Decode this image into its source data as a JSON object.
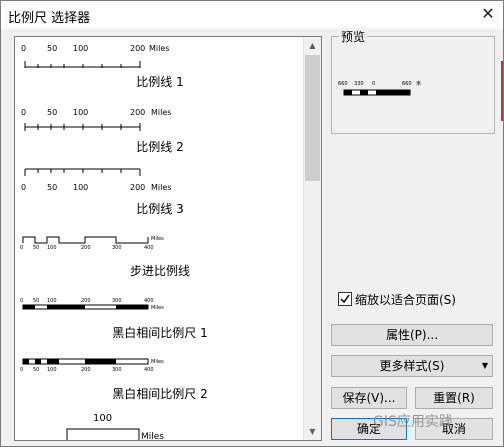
{
  "window": {
    "title": "比例尺 选择器"
  },
  "list": {
    "items": [
      {
        "name": "比例线 1",
        "ticks": [
          "0",
          "50",
          "100",
          "200"
        ],
        "unit": "Miles"
      },
      {
        "name": "比例线 2",
        "ticks": [
          "0",
          "50",
          "100",
          "200"
        ],
        "unit": "Miles"
      },
      {
        "name": "比例线 3",
        "ticks": [
          "0",
          "50",
          "100",
          "200"
        ],
        "unit": "Miles"
      },
      {
        "name": "步进比例线",
        "ticks": [
          "0",
          "50",
          "100",
          "200",
          "300",
          "400"
        ],
        "unit": "Miles"
      },
      {
        "name": "黑白相间比例尺 1",
        "ticks": [
          "0",
          "50",
          "100",
          "200",
          "300",
          "400"
        ],
        "unit": "Miles"
      },
      {
        "name": "黑白相间比例尺 2",
        "ticks": [
          "0",
          "50",
          "100",
          "200",
          "300",
          "400"
        ],
        "unit": "Miles"
      },
      {
        "name": "",
        "ticks": [
          "100"
        ],
        "unit": "Miles"
      }
    ]
  },
  "preview": {
    "title": "预览",
    "ticks": [
      "660",
      "330",
      "0",
      "660"
    ],
    "unit": "米"
  },
  "options": {
    "fit_to_page_label": "缩放以适合页面(S)",
    "fit_to_page_checked": true
  },
  "buttons": {
    "properties": "属性(P)...",
    "more_styles": "更多样式(S)",
    "save": "保存(V)...",
    "reset": "重置(R)",
    "ok": "确定",
    "cancel": "取消"
  },
  "watermark": "GIS应用实践",
  "icons": {
    "close": "close-icon",
    "scroll_up": "scroll-up-arrow-icon",
    "scroll_down": "scroll-down-arrow-icon",
    "dropdown": "dropdown-arrow-icon",
    "check": "checkmark-icon"
  }
}
